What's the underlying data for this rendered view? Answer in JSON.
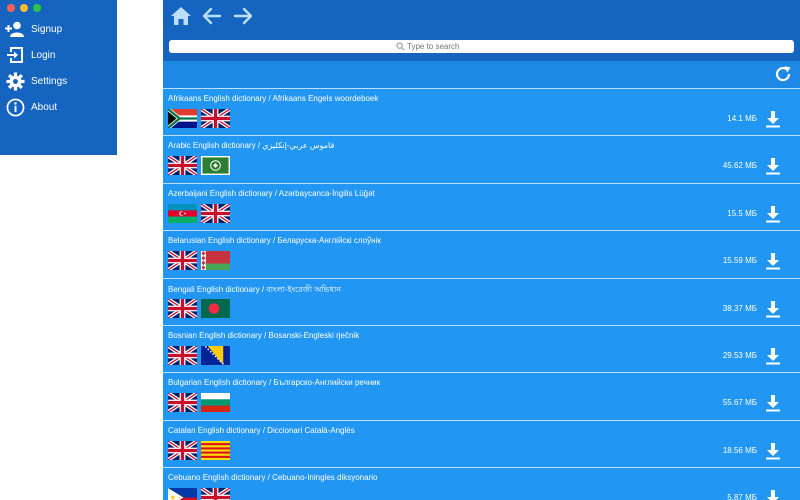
{
  "sidebar": {
    "items": [
      {
        "label": "Signup",
        "icon": "add-user-icon"
      },
      {
        "label": "Login",
        "icon": "login-icon"
      },
      {
        "label": "Settings",
        "icon": "gear-icon"
      },
      {
        "label": "About",
        "icon": "info-icon"
      }
    ]
  },
  "search": {
    "placeholder": "Type to search"
  },
  "colors": {
    "sidebar": "#1565c0",
    "main": "#1565c0",
    "toolbar": "#1e88e5",
    "row": "#2196f3"
  },
  "dictionaries": [
    {
      "title": "Afrikaans English dictionary / Afrikaans Engels woordeboek",
      "size": "14.1 МБ",
      "flags": [
        "flag-za-icon",
        "flag-gb-icon"
      ]
    },
    {
      "title": "Arabic English dictionary / قاموس عربي-إنكليزي",
      "size": "45.62 МБ",
      "flags": [
        "flag-gb-icon",
        "flag-arab-icon"
      ]
    },
    {
      "title": "Azerbaijani English dictionary / Azərbaycanca-İngilis Lüğət",
      "size": "15.5 МБ",
      "flags": [
        "flag-az-icon",
        "flag-gb-icon"
      ]
    },
    {
      "title": "Belarusian English dictionary / Беларуска-Англійскі слоўнік",
      "size": "15.59 МБ",
      "flags": [
        "flag-gb-icon",
        "flag-by-icon"
      ]
    },
    {
      "title": "Bengali English dictionary / বাংলা-ইংরেজী অভিধান",
      "size": "38.37 МБ",
      "flags": [
        "flag-gb-icon",
        "flag-bd-icon"
      ]
    },
    {
      "title": "Bosnian English dictionary / Bosanski-Engleski rječnik",
      "size": "29.53 МБ",
      "flags": [
        "flag-gb-icon",
        "flag-ba-icon"
      ]
    },
    {
      "title": "Bulgarian English dictionary / Българско-Английски речник",
      "size": "55.67 МБ",
      "flags": [
        "flag-gb-icon",
        "flag-bg-icon"
      ]
    },
    {
      "title": "Catalan English dictionary / Diccionari Català-Anglès",
      "size": "18.56 МБ",
      "flags": [
        "flag-gb-icon",
        "flag-cat-icon"
      ]
    },
    {
      "title": "Cebuano English dictionary / Cebuano-Iningles diksyonario",
      "size": "5.87 МБ",
      "flags": [
        "flag-ph-icon",
        "flag-gb-icon"
      ]
    }
  ]
}
